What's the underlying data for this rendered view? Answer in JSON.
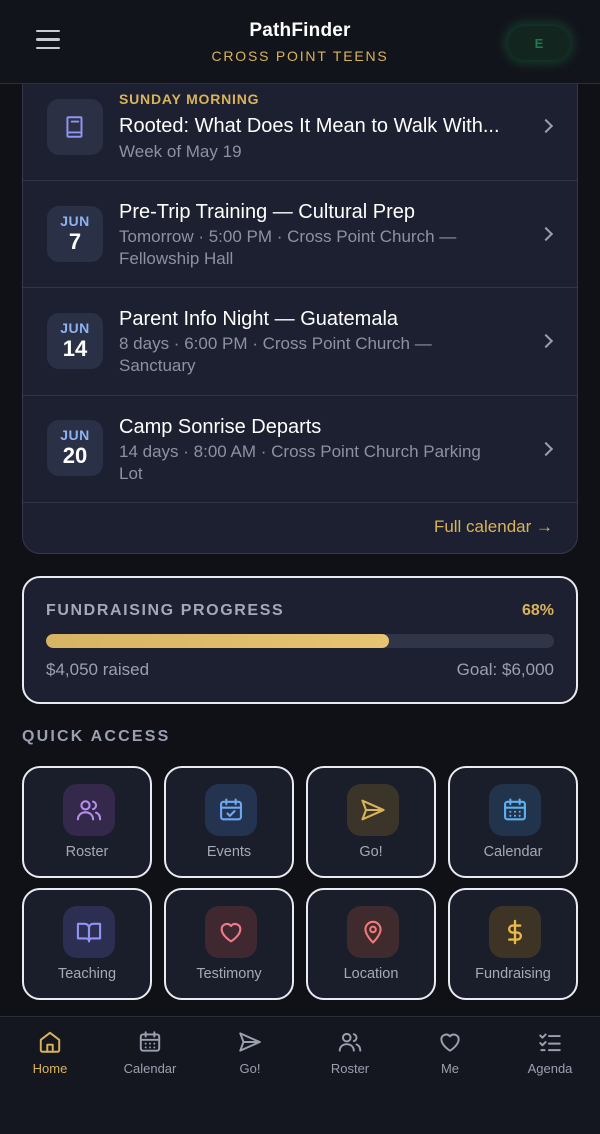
{
  "header": {
    "title": "PathFinder",
    "subtitle": "CROSS POINT TEENS",
    "avatar_initials": "E"
  },
  "schedule": {
    "items": [
      {
        "eyebrow": "SUNDAY MORNING",
        "title": "Rooted: What Does It Mean to Walk With...",
        "subtitle": "Week of May 19",
        "icon": "book-icon"
      },
      {
        "month": "JUN",
        "day": "7",
        "title": "Pre-Trip Training — Cultural Prep",
        "subtitle": "Tomorrow · 5:00 PM · Cross Point Church — Fellowship Hall"
      },
      {
        "month": "JUN",
        "day": "14",
        "title": "Parent Info Night — Guatemala",
        "subtitle": "8 days · 6:00 PM · Cross Point Church — Sanctuary"
      },
      {
        "month": "JUN",
        "day": "20",
        "title": "Camp Sonrise Departs",
        "subtitle": "14 days · 8:00 AM · Cross Point Church Parking Lot"
      }
    ],
    "full_calendar_label": "Full calendar →"
  },
  "fundraising": {
    "label": "FUNDRAISING PROGRESS",
    "percent_label": "68%",
    "progress_fraction": 0.675,
    "raised": "$4,050 raised",
    "goal": "Goal: $6,000"
  },
  "quick_access": {
    "title": "QUICK ACCESS",
    "tiles": [
      {
        "label": "Roster",
        "icon": "users-icon",
        "color": "#b98cf0",
        "bg": "#34294a"
      },
      {
        "label": "Events",
        "icon": "calendar-check-icon",
        "color": "#6fa8f0",
        "bg": "#243350"
      },
      {
        "label": "Go!",
        "icon": "send-icon",
        "color": "#d9b35a",
        "bg": "#3a3528"
      },
      {
        "label": "Calendar",
        "icon": "calendar-grid-icon",
        "color": "#5fb0f0",
        "bg": "#22344c"
      },
      {
        "label": "Teaching",
        "icon": "book-open-icon",
        "color": "#8f94f5",
        "bg": "#2c2f52"
      },
      {
        "label": "Testimony",
        "icon": "heart-icon",
        "color": "#f07a8a",
        "bg": "#3f2830"
      },
      {
        "label": "Location",
        "icon": "map-pin-icon",
        "color": "#f07a7a",
        "bg": "#3f2a2e"
      },
      {
        "label": "Fundraising",
        "icon": "dollar-icon",
        "color": "#e8b84a",
        "bg": "#3d3425"
      }
    ]
  },
  "bottom_nav": {
    "items": [
      {
        "label": "Home",
        "icon": "home-icon",
        "active": true
      },
      {
        "label": "Calendar",
        "icon": "calendar-icon",
        "active": false
      },
      {
        "label": "Go!",
        "icon": "send-icon",
        "active": false
      },
      {
        "label": "Roster",
        "icon": "users-icon",
        "active": false
      },
      {
        "label": "Me",
        "icon": "heart-icon",
        "active": false
      },
      {
        "label": "Agenda",
        "icon": "checklist-icon",
        "active": false
      }
    ]
  },
  "colors": {
    "accent": "#d9b35a",
    "background": "#0f1117",
    "card": "#1c2030"
  }
}
